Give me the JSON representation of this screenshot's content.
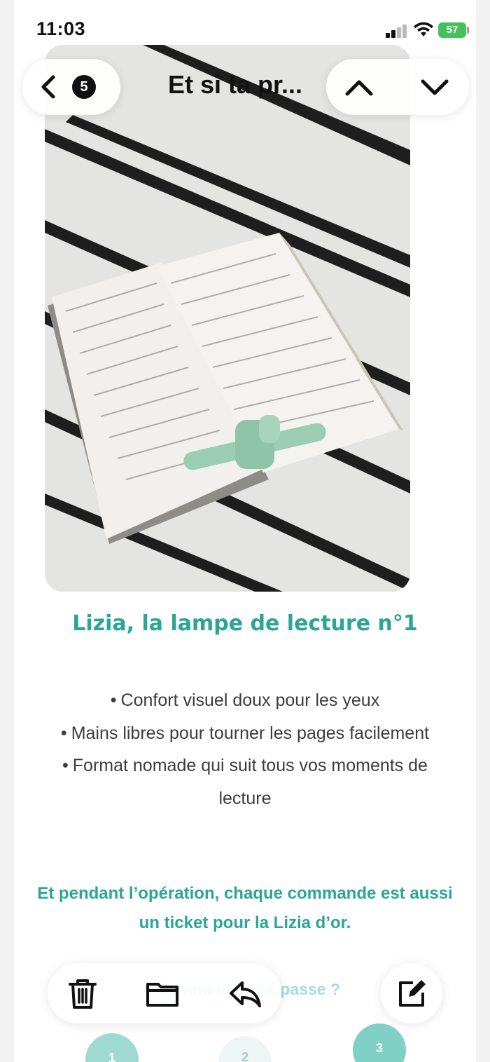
{
  "status_bar": {
    "time": "11:03",
    "battery": "57"
  },
  "nav": {
    "back_count": "5",
    "title": "Et si ta pr..."
  },
  "content": {
    "product_title": "Lizia, la lampe de lecture n°1",
    "features": [
      {
        "bullet": "•",
        "text": "Confort visuel doux pour les yeux"
      },
      {
        "bullet": "•",
        "text": "Mains libres pour tourner les pages facilement"
      },
      {
        "bullet": "•",
        "text": "Format nomade qui suit tous vos moments de lecture"
      }
    ],
    "promo": "Et pendant l’opération, chaque commande est aussi un ticket pour la Lizia d’or.",
    "section_heading": "Comment ça se passe ?",
    "steps": [
      "1",
      "2",
      "3"
    ]
  },
  "icons": {
    "back": "chevron-left-icon",
    "up": "chevron-up-icon",
    "down": "chevron-down-icon",
    "trash": "trash-icon",
    "folder": "folder-icon",
    "reply": "reply-icon",
    "compose": "compose-icon"
  },
  "colors": {
    "accent": "#2aa596",
    "battery": "#44c25a",
    "product_mint": "#9ccdb4"
  }
}
